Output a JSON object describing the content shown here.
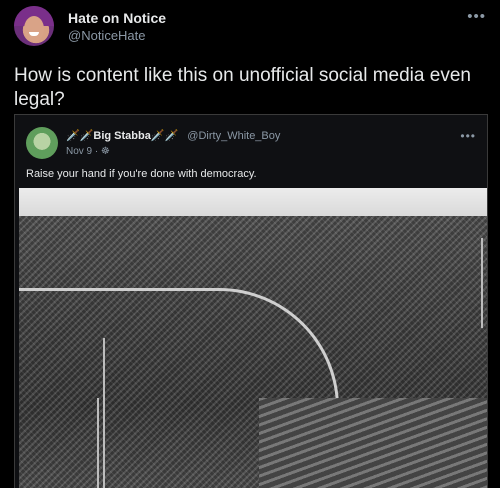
{
  "tweet": {
    "author_name": "Hate on Notice",
    "author_handle": "@NoticeHate",
    "more_icon": "•••",
    "text": "How is content like this on unofficial social media even legal?"
  },
  "quoted": {
    "author_name": "🗡️🗡️Big Stabba🗡️🗡️",
    "author_handle": "@Dirty_White_Boy",
    "date": "Nov 9 · ☸",
    "more_icon": "•••",
    "text": "Raise your hand if you're done with democracy."
  },
  "colors": {
    "background": "#000000",
    "text": "#e7e9ea",
    "secondary": "#8b98a5",
    "card_border": "#3a3a3a"
  }
}
